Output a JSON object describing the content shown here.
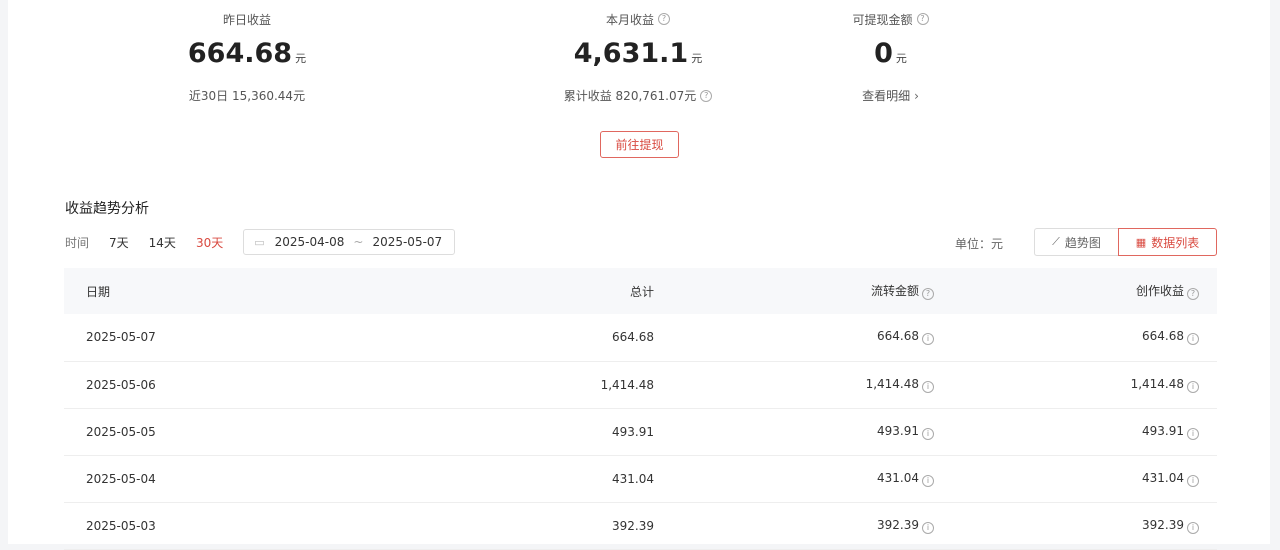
{
  "stats": {
    "yesterday": {
      "label": "昨日收益",
      "value": "664.68",
      "unit": "元",
      "sub": "近30日 15,360.44元"
    },
    "month": {
      "label": "本月收益",
      "value": "4,631.1",
      "unit": "元",
      "sub": "累计收益 820,761.07元"
    },
    "withdrawable": {
      "label": "可提现金额",
      "value": "0",
      "unit": "元",
      "sub": "查看明细"
    }
  },
  "withdraw_button": "前往提现",
  "trend": {
    "title": "收益趋势分析",
    "time_label": "时间",
    "ranges": [
      "7天",
      "14天",
      "30天"
    ],
    "active_range": "30天",
    "date_start": "2025-04-08",
    "date_sep": "~",
    "date_end": "2025-05-07",
    "unit_label": "单位：元",
    "view_trend": "趋势图",
    "view_list": "数据列表"
  },
  "table": {
    "headers": {
      "date": "日期",
      "total": "总计",
      "flow": "流转金额",
      "create": "创作收益"
    },
    "rows": [
      {
        "date": "2025-05-07",
        "total": "664.68",
        "flow": "664.68",
        "create": "664.68"
      },
      {
        "date": "2025-05-06",
        "total": "1,414.48",
        "flow": "1,414.48",
        "create": "1,414.48"
      },
      {
        "date": "2025-05-05",
        "total": "493.91",
        "flow": "493.91",
        "create": "493.91"
      },
      {
        "date": "2025-05-04",
        "total": "431.04",
        "flow": "431.04",
        "create": "431.04"
      },
      {
        "date": "2025-05-03",
        "total": "392.39",
        "flow": "392.39",
        "create": "392.39"
      }
    ]
  },
  "colors": {
    "accent": "#d94a40"
  }
}
